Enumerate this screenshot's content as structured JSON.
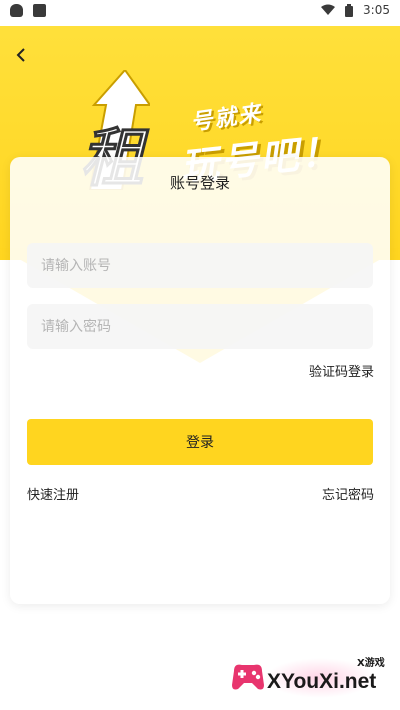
{
  "status_bar": {
    "time": "3:05"
  },
  "header": {
    "back_icon": "chevron-left-icon",
    "logo_text_line1": "号就来",
    "logo_text_line2": "玩号吧！",
    "logo_char": "租"
  },
  "card": {
    "title": "账号登录",
    "account_placeholder": "请输入账号",
    "password_placeholder": "请输入密码",
    "sms_login_label": "验证码登录",
    "login_button_label": "登录",
    "register_label": "快速注册",
    "forgot_password_label": "忘记密码"
  },
  "watermark": {
    "small_text": "X游戏",
    "big_text": "XYouXi.net"
  },
  "colors": {
    "accent": "#ffd51f",
    "header_top": "#ffe03b",
    "logo_shadow": "#c99e00"
  }
}
